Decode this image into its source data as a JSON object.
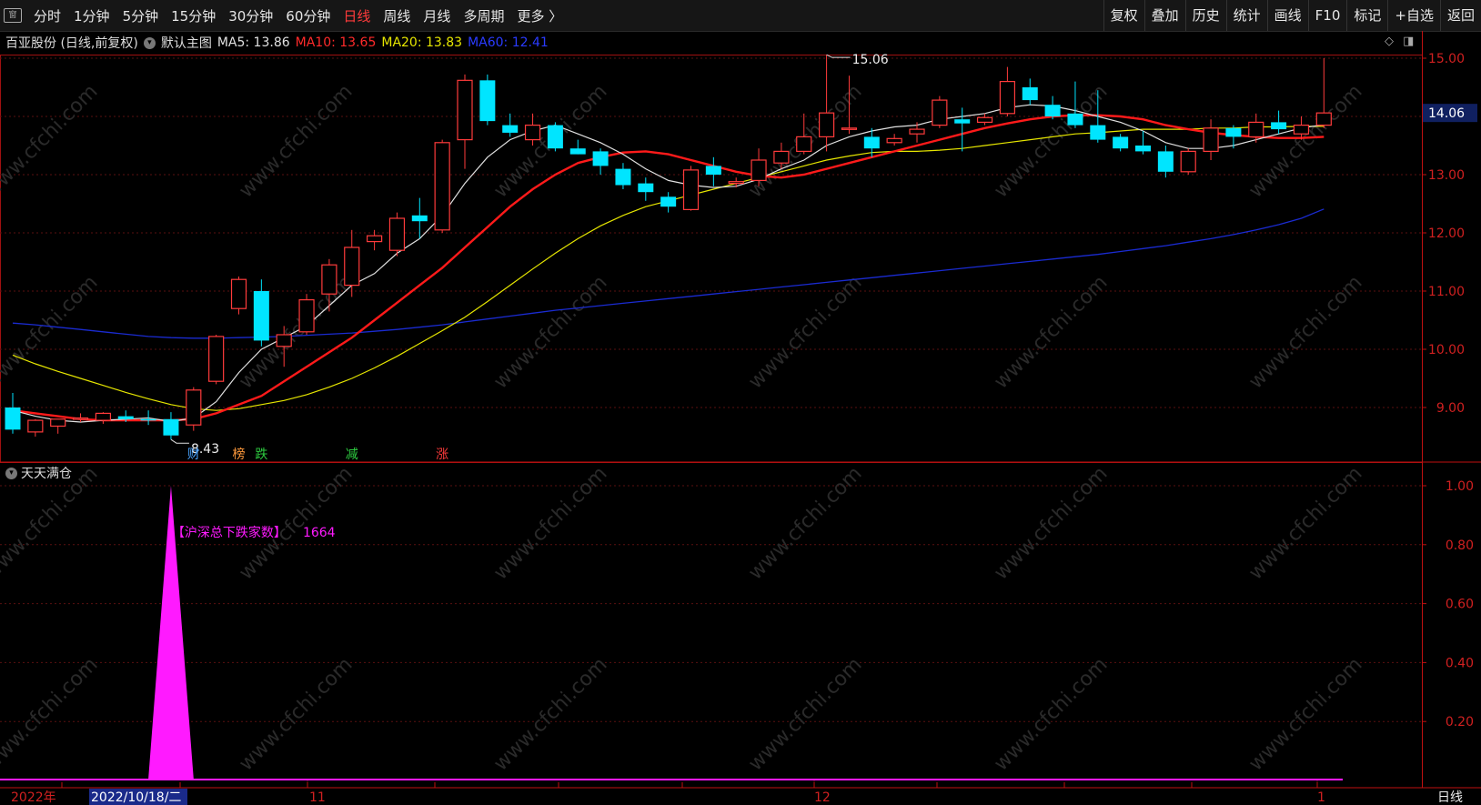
{
  "toolbar": {
    "app_icon": "窗",
    "periods": [
      "分时",
      "1分钟",
      "5分钟",
      "15分钟",
      "30分钟",
      "60分钟",
      "日线",
      "周线",
      "月线",
      "多周期",
      "更多 〉"
    ],
    "active_period": "日线",
    "right_buttons": [
      "复权",
      "叠加",
      "历史",
      "统计",
      "画线",
      "F10",
      "标记",
      "+自选",
      "返回"
    ]
  },
  "main_chart": {
    "title": "百亚股份 (日线,前复权)",
    "template": "默认主图",
    "ma5": "MA5: 13.86",
    "ma10": "MA10: 13.65",
    "ma20": "MA20: 13.83",
    "ma60": "MA60: 12.41",
    "high_label": "15.06",
    "low_label": "8.43",
    "current_price": "14.06",
    "y_ticks": [
      "15.00",
      "14.00",
      "13.00",
      "12.00",
      "11.00",
      "10.00",
      "9.00"
    ],
    "badges": [
      {
        "text": "财",
        "color": "#4aa3ff"
      },
      {
        "text": "榜",
        "color": "#ff9a3c"
      },
      {
        "text": "跌",
        "color": "#2ecc40"
      },
      {
        "text": "减",
        "color": "#2ecc40"
      },
      {
        "text": "涨",
        "color": "#ff3b3b"
      }
    ]
  },
  "indicator": {
    "title": "天天满仓",
    "label": "【沪深总下跌家数】",
    "value": "1664",
    "y_ticks": [
      "1.00",
      "0.80",
      "0.60",
      "0.40",
      "0.20"
    ]
  },
  "bottom_axis": {
    "labels": [
      "2022年",
      "2022/10/18/二",
      "11",
      "12",
      "1"
    ],
    "period": "日线"
  },
  "watermark": "www.cfchi.com",
  "colors": {
    "up": "#ff3b3b",
    "down": "#00e5ff",
    "ma5": "#e0e0e0",
    "ma10": "#ff1a1a",
    "ma20": "#e6e600",
    "ma60": "#1a2bd1",
    "indicator": "#ff1aff"
  },
  "chart_data": {
    "type": "candlestick",
    "title": "",
    "candles": [
      {
        "o": 9.0,
        "h": 9.25,
        "l": 8.55,
        "c": 8.62
      },
      {
        "o": 8.58,
        "h": 8.8,
        "l": 8.5,
        "c": 8.78
      },
      {
        "o": 8.68,
        "h": 8.8,
        "l": 8.55,
        "c": 8.8
      },
      {
        "o": 8.8,
        "h": 8.9,
        "l": 8.75,
        "c": 8.82
      },
      {
        "o": 8.78,
        "h": 8.92,
        "l": 8.72,
        "c": 8.9
      },
      {
        "o": 8.85,
        "h": 8.95,
        "l": 8.75,
        "c": 8.8
      },
      {
        "o": 8.8,
        "h": 8.95,
        "l": 8.7,
        "c": 8.78
      },
      {
        "o": 8.8,
        "h": 8.92,
        "l": 8.45,
        "c": 8.52
      },
      {
        "o": 8.7,
        "h": 9.35,
        "l": 8.6,
        "c": 9.3
      },
      {
        "o": 9.45,
        "h": 10.25,
        "l": 9.4,
        "c": 10.22
      },
      {
        "o": 10.7,
        "h": 11.25,
        "l": 10.6,
        "c": 11.2
      },
      {
        "o": 11.0,
        "h": 11.2,
        "l": 10.05,
        "c": 10.15
      },
      {
        "o": 10.05,
        "h": 10.4,
        "l": 9.7,
        "c": 10.25
      },
      {
        "o": 10.3,
        "h": 10.95,
        "l": 10.25,
        "c": 10.85
      },
      {
        "o": 10.95,
        "h": 11.55,
        "l": 10.65,
        "c": 11.45
      },
      {
        "o": 11.1,
        "h": 12.05,
        "l": 10.9,
        "c": 11.75
      },
      {
        "o": 11.85,
        "h": 12.05,
        "l": 11.7,
        "c": 11.95
      },
      {
        "o": 11.7,
        "h": 12.35,
        "l": 11.6,
        "c": 12.25
      },
      {
        "o": 12.3,
        "h": 12.6,
        "l": 11.9,
        "c": 12.2
      },
      {
        "o": 12.05,
        "h": 13.6,
        "l": 12.0,
        "c": 13.55
      },
      {
        "o": 13.6,
        "h": 14.72,
        "l": 13.1,
        "c": 14.62
      },
      {
        "o": 14.62,
        "h": 14.72,
        "l": 13.85,
        "c": 13.92
      },
      {
        "o": 13.85,
        "h": 14.05,
        "l": 13.65,
        "c": 13.72
      },
      {
        "o": 13.6,
        "h": 14.05,
        "l": 13.5,
        "c": 13.85
      },
      {
        "o": 13.85,
        "h": 13.9,
        "l": 13.4,
        "c": 13.45
      },
      {
        "o": 13.45,
        "h": 13.6,
        "l": 13.35,
        "c": 13.35
      },
      {
        "o": 13.4,
        "h": 13.45,
        "l": 13.0,
        "c": 13.15
      },
      {
        "o": 13.1,
        "h": 13.2,
        "l": 12.75,
        "c": 12.82
      },
      {
        "o": 12.85,
        "h": 12.95,
        "l": 12.55,
        "c": 12.7
      },
      {
        "o": 12.62,
        "h": 12.7,
        "l": 12.35,
        "c": 12.45
      },
      {
        "o": 12.4,
        "h": 13.15,
        "l": 12.38,
        "c": 13.08
      },
      {
        "o": 13.15,
        "h": 13.3,
        "l": 12.8,
        "c": 13.0
      },
      {
        "o": 12.85,
        "h": 12.95,
        "l": 12.78,
        "c": 12.88
      },
      {
        "o": 12.9,
        "h": 13.45,
        "l": 12.8,
        "c": 13.25
      },
      {
        "o": 13.2,
        "h": 13.55,
        "l": 13.1,
        "c": 13.4
      },
      {
        "o": 13.4,
        "h": 14.05,
        "l": 13.35,
        "c": 13.65
      },
      {
        "o": 13.65,
        "h": 15.06,
        "l": 13.4,
        "c": 14.06
      },
      {
        "o": 13.8,
        "h": 14.7,
        "l": 13.7,
        "c": 13.8
      },
      {
        "o": 13.65,
        "h": 13.8,
        "l": 13.3,
        "c": 13.45
      },
      {
        "o": 13.55,
        "h": 13.7,
        "l": 13.5,
        "c": 13.62
      },
      {
        "o": 13.7,
        "h": 13.9,
        "l": 13.55,
        "c": 13.78
      },
      {
        "o": 13.85,
        "h": 14.35,
        "l": 13.8,
        "c": 14.28
      },
      {
        "o": 13.95,
        "h": 14.15,
        "l": 13.4,
        "c": 13.88
      },
      {
        "o": 13.9,
        "h": 14.05,
        "l": 13.85,
        "c": 13.98
      },
      {
        "o": 14.05,
        "h": 14.85,
        "l": 14.0,
        "c": 14.6
      },
      {
        "o": 14.5,
        "h": 14.65,
        "l": 14.2,
        "c": 14.28
      },
      {
        "o": 14.2,
        "h": 14.35,
        "l": 13.95,
        "c": 14.0
      },
      {
        "o": 14.05,
        "h": 14.6,
        "l": 13.8,
        "c": 13.85
      },
      {
        "o": 13.85,
        "h": 14.45,
        "l": 13.55,
        "c": 13.6
      },
      {
        "o": 13.65,
        "h": 13.7,
        "l": 13.4,
        "c": 13.45
      },
      {
        "o": 13.5,
        "h": 13.75,
        "l": 13.35,
        "c": 13.4
      },
      {
        "o": 13.4,
        "h": 13.5,
        "l": 12.95,
        "c": 13.05
      },
      {
        "o": 13.05,
        "h": 13.45,
        "l": 13.0,
        "c": 13.4
      },
      {
        "o": 13.4,
        "h": 13.95,
        "l": 13.25,
        "c": 13.8
      },
      {
        "o": 13.8,
        "h": 13.85,
        "l": 13.45,
        "c": 13.65
      },
      {
        "o": 13.65,
        "h": 14.05,
        "l": 13.55,
        "c": 13.9
      },
      {
        "o": 13.9,
        "h": 14.1,
        "l": 13.7,
        "c": 13.78
      },
      {
        "o": 13.7,
        "h": 14.0,
        "l": 13.6,
        "c": 13.85
      },
      {
        "o": 13.85,
        "h": 15.0,
        "l": 13.8,
        "c": 14.06
      }
    ],
    "ma5": [
      8.95,
      8.85,
      8.78,
      8.75,
      8.78,
      8.8,
      8.82,
      8.76,
      8.82,
      9.1,
      9.6,
      10.0,
      10.2,
      10.4,
      10.75,
      11.1,
      11.3,
      11.65,
      11.9,
      12.3,
      12.85,
      13.3,
      13.6,
      13.75,
      13.85,
      13.7,
      13.55,
      13.35,
      13.1,
      12.9,
      12.82,
      12.78,
      12.8,
      12.92,
      13.1,
      13.25,
      13.5,
      13.65,
      13.75,
      13.82,
      13.85,
      13.95,
      14.0,
      14.05,
      14.15,
      14.2,
      14.18,
      14.1,
      14.0,
      13.9,
      13.75,
      13.55,
      13.45,
      13.45,
      13.5,
      13.6,
      13.7,
      13.8,
      13.86
    ],
    "ma10": [
      8.95,
      8.9,
      8.85,
      8.8,
      8.78,
      8.78,
      8.78,
      8.78,
      8.8,
      8.9,
      9.05,
      9.2,
      9.45,
      9.7,
      9.95,
      10.2,
      10.5,
      10.8,
      11.1,
      11.4,
      11.75,
      12.1,
      12.45,
      12.75,
      13.0,
      13.2,
      13.3,
      13.38,
      13.4,
      13.35,
      13.25,
      13.15,
      13.05,
      12.98,
      12.95,
      13.0,
      13.1,
      13.2,
      13.3,
      13.4,
      13.5,
      13.6,
      13.7,
      13.8,
      13.88,
      13.95,
      14.0,
      14.02,
      14.02,
      14.0,
      13.95,
      13.85,
      13.78,
      13.72,
      13.68,
      13.65,
      13.63,
      13.63,
      13.65
    ],
    "ma20": [
      9.9,
      9.75,
      9.62,
      9.5,
      9.38,
      9.26,
      9.15,
      9.05,
      8.98,
      8.95,
      8.98,
      9.05,
      9.12,
      9.22,
      9.35,
      9.5,
      9.68,
      9.88,
      10.1,
      10.32,
      10.55,
      10.82,
      11.1,
      11.38,
      11.65,
      11.9,
      12.12,
      12.3,
      12.45,
      12.55,
      12.65,
      12.75,
      12.85,
      12.95,
      13.05,
      13.15,
      13.25,
      13.32,
      13.38,
      13.4,
      13.4,
      13.42,
      13.45,
      13.5,
      13.55,
      13.6,
      13.65,
      13.7,
      13.72,
      13.75,
      13.78,
      13.78,
      13.78,
      13.8,
      13.8,
      13.82,
      13.82,
      13.83,
      13.83
    ],
    "ma60": [
      10.45,
      10.42,
      10.38,
      10.34,
      10.3,
      10.26,
      10.22,
      10.2,
      10.19,
      10.19,
      10.2,
      10.21,
      10.22,
      10.24,
      10.26,
      10.28,
      10.31,
      10.34,
      10.38,
      10.42,
      10.47,
      10.52,
      10.57,
      10.62,
      10.67,
      10.71,
      10.75,
      10.79,
      10.83,
      10.87,
      10.91,
      10.95,
      10.99,
      11.03,
      11.07,
      11.11,
      11.15,
      11.19,
      11.23,
      11.27,
      11.31,
      11.35,
      11.39,
      11.43,
      11.47,
      11.51,
      11.55,
      11.59,
      11.63,
      11.68,
      11.73,
      11.78,
      11.84,
      11.9,
      11.97,
      12.05,
      12.14,
      12.25,
      12.41
    ],
    "indicator_series": {
      "name": "沪深总下跌家数",
      "peak_index": 7,
      "peak_value": 1.0
    },
    "ylim": [
      8.3,
      15.3
    ],
    "indicator_ylim": [
      0,
      1.1
    ]
  }
}
